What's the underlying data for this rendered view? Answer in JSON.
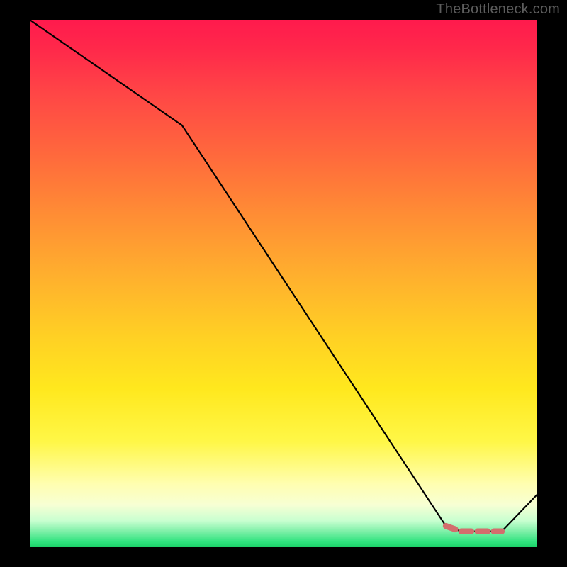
{
  "watermark": "TheBottleneck.com",
  "chart_data": {
    "type": "line",
    "title": "",
    "xlabel": "",
    "ylabel": "",
    "xlim": [
      0,
      100
    ],
    "ylim": [
      0,
      100
    ],
    "series": [
      {
        "name": "bottleneck-curve",
        "x": [
          0,
          30,
          82,
          85,
          88,
          91,
          93,
          100
        ],
        "values": [
          100,
          80,
          4,
          3,
          3,
          3,
          3,
          10
        ]
      }
    ],
    "highlight": {
      "name": "optimal-range-marker",
      "color": "#d36d6d",
      "x": [
        82,
        85,
        88,
        91,
        93
      ],
      "values": [
        4,
        3,
        3,
        3,
        3
      ]
    },
    "annotations": []
  },
  "colors": {
    "line": "#000000",
    "marker": "#d36d6d",
    "background_top": "#ff1a4d",
    "background_bottom": "#1cd268"
  }
}
